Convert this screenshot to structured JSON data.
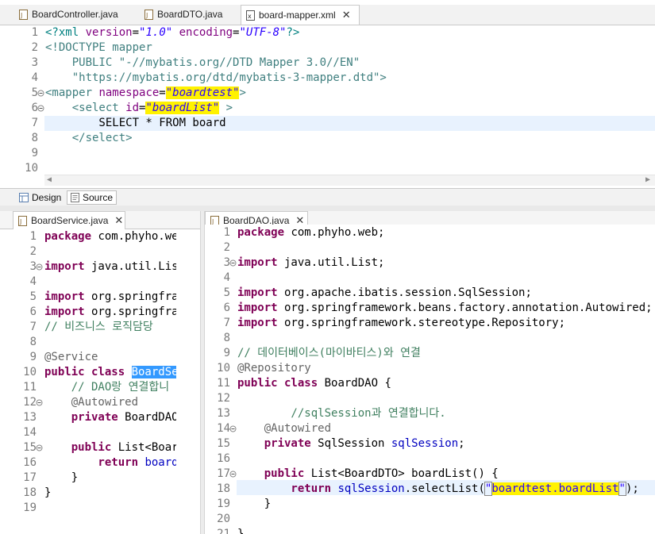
{
  "top_tabs": [
    {
      "label": "BoardController.java",
      "icon": "java-file-icon",
      "active": false
    },
    {
      "label": "BoardDTO.java",
      "icon": "java-file-icon",
      "active": false
    },
    {
      "label": "board-mapper.xml",
      "icon": "xml-file-icon",
      "active": true
    }
  ],
  "xml_editor": {
    "line_numbers": [
      "1",
      "2",
      "3",
      "4",
      "5",
      "6",
      "7",
      "8",
      "9",
      "10"
    ],
    "lines": {
      "l1_a": "<?xml ",
      "l1_b": "version",
      "l1_c": "=",
      "l1_d": "\"1.0\"",
      "l1_e": " encoding",
      "l1_f": "=",
      "l1_g": "\"UTF-8\"",
      "l1_h": "?>",
      "l2": "<!DOCTYPE mapper",
      "l3": "    PUBLIC \"-//mybatis.org//DTD Mapper 3.0//EN\"",
      "l4": "    \"https://mybatis.org/dtd/mybatis-3-mapper.dtd\">",
      "l5_a": "<mapper ",
      "l5_b": "namespace",
      "l5_c": "=",
      "l5_d": "\"boardtest\"",
      "l5_e": ">",
      "l6_a": "    <select ",
      "l6_b": "id",
      "l6_c": "=",
      "l6_d": "\"boardList\"",
      "l6_e": " >",
      "l7": "        SELECT * FROM board",
      "l8": "    </select>",
      "l9": "",
      "l10": ""
    },
    "bottom_tabs": {
      "design": "Design",
      "source": "Source"
    }
  },
  "service_editor": {
    "tab_label": "BoardService.java",
    "line_numbers": [
      "1",
      "2",
      "3",
      "4",
      "5",
      "6",
      "7",
      "8",
      "9",
      "10",
      "11",
      "12",
      "13",
      "14",
      "15",
      "16",
      "17",
      "18",
      "19"
    ],
    "lines": {
      "l1_kw": "package",
      "l1_rest": " com.phyho.web",
      "l3_kw": "import",
      "l3_rest": " java.util.List",
      "l5_kw": "import",
      "l5_rest": " org.springfram",
      "l6_kw": "import",
      "l6_rest": " org.springfram",
      "l7": "// 비즈니스 로직담당",
      "l9": "@Service",
      "l10_kw": "public class ",
      "l10_sel": "BoardSer",
      "l11": "    // DAO랑 연결합니",
      "l12": "    @Autowired",
      "l13_kw": "    private",
      "l13_rest": " BoardDAO",
      "l15_kw": "    public",
      "l15_rest": " List<Board",
      "l16_kw": "        return",
      "l16_rest": " boardD",
      "l17": "    }",
      "l18": "}"
    }
  },
  "dao_editor": {
    "tab_label": "BoardDAO.java",
    "line_numbers": [
      "1",
      "2",
      "3",
      "4",
      "5",
      "6",
      "7",
      "8",
      "9",
      "10",
      "11",
      "12",
      "13",
      "14",
      "15",
      "16",
      "17",
      "18",
      "19",
      "20",
      "21"
    ],
    "lines": {
      "l1_kw": "package",
      "l1_rest": " com.phyho.web;",
      "l3_kw": "import",
      "l3_rest": " java.util.List;",
      "l5_kw": "import",
      "l5_rest": " org.apache.ibatis.session.SqlSession;",
      "l6_kw": "import",
      "l6_rest": " org.springframework.beans.factory.annotation.Autowired;",
      "l7_kw": "import",
      "l7_rest": " org.springframework.stereotype.Repository;",
      "l9": "// 데이터베이스(마이바티스)와 연결",
      "l10": "@Repository",
      "l11_kw": "public class",
      "l11_rest": " BoardDAO {",
      "l13": "        //sqlSession과 연결합니다.",
      "l14": "    @Autowired",
      "l15_kw": "    private",
      "l15_rest": " SqlSession ",
      "l15_fld": "sqlSession",
      "l15_end": ";",
      "l17_kw": "    public",
      "l17_rest": " List<BoardDTO> boardList() {",
      "l18_kw": "        return",
      "l18_sp": " ",
      "l18_fld": "sqlSession",
      "l18_mid": ".selectList(",
      "l18_q1": "\"",
      "l18_str": "boardtest.boardList",
      "l18_q2": "\"",
      "l18_end": ");",
      "l19": "    }",
      "l21": "}"
    }
  }
}
